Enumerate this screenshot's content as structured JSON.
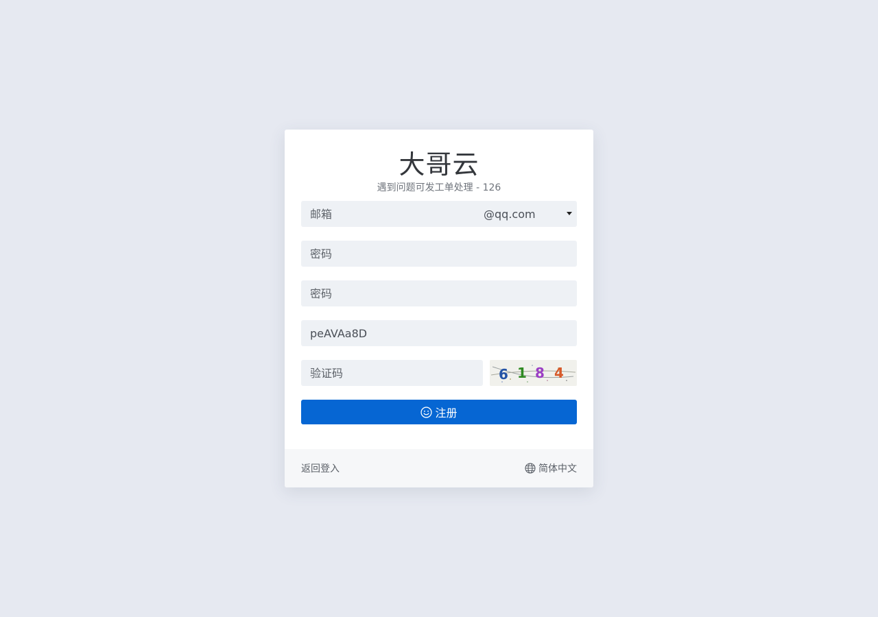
{
  "card": {
    "title": "大哥云",
    "subtitle": "遇到问题可发工单处理 - 126"
  },
  "form": {
    "email_placeholder": "邮箱",
    "email_suffix": "@qq.com",
    "password_placeholder": "密码",
    "confirm_password_placeholder": "密码",
    "invite_code_value": "peAVAa8D",
    "captcha_placeholder": "验证码",
    "captcha_chars": [
      "6",
      "1",
      "8",
      "4"
    ],
    "captcha_colors": [
      "#2554a6",
      "#2f8a22",
      "#9b3fc4",
      "#d65a2a"
    ],
    "submit_label": "注册",
    "submit_icon": "smile-icon",
    "accent_color": "#0666d3"
  },
  "footer": {
    "back_to_login": "返回登入",
    "language": "简体中文",
    "language_icon": "globe-icon"
  }
}
